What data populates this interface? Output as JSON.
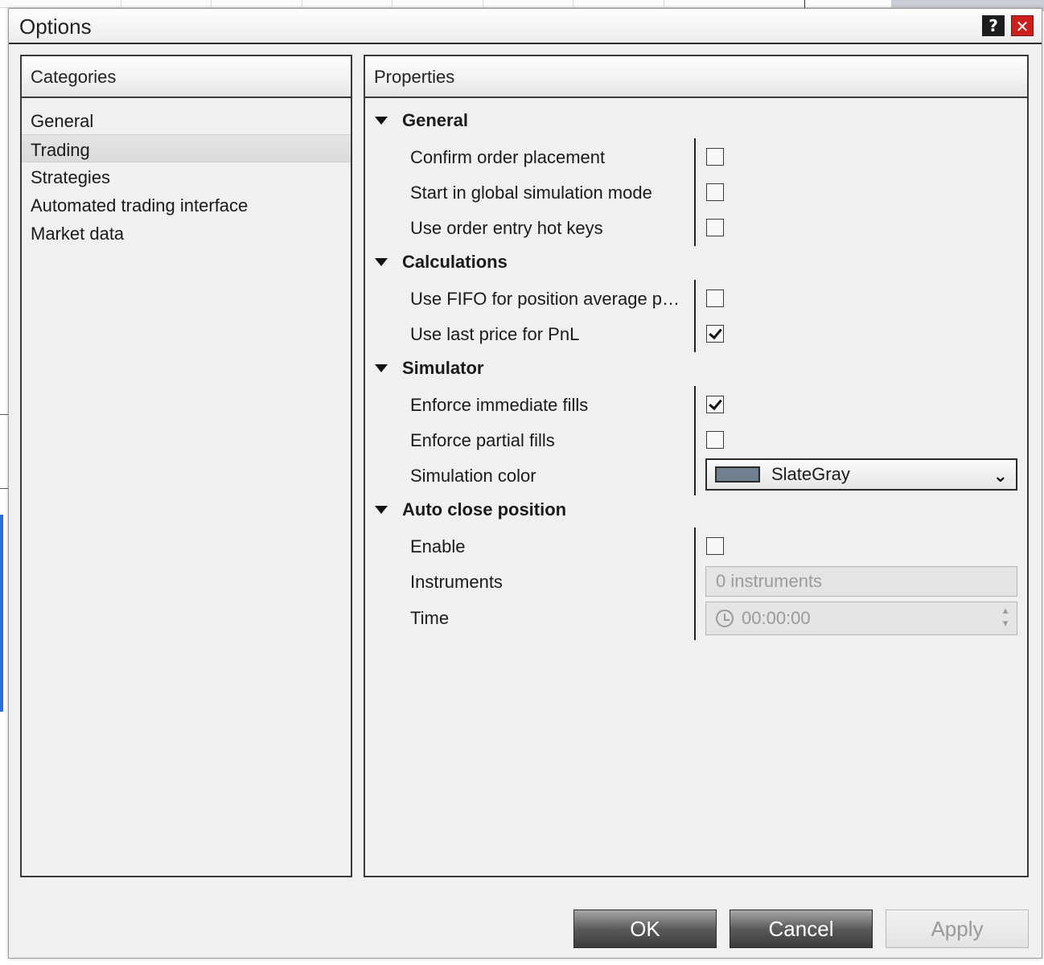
{
  "dialog": {
    "title": "Options",
    "help_icon": "?",
    "close_icon": "✕"
  },
  "categories": {
    "header": "Categories",
    "items": [
      {
        "label": "General",
        "selected": false
      },
      {
        "label": "Trading",
        "selected": true
      },
      {
        "label": "Strategies",
        "selected": false
      },
      {
        "label": "Automated trading interface",
        "selected": false
      },
      {
        "label": "Market data",
        "selected": false
      }
    ]
  },
  "properties": {
    "header": "Properties",
    "groups": [
      {
        "title": "General",
        "rows": [
          {
            "label": "Confirm order placement",
            "type": "checkbox",
            "checked": false
          },
          {
            "label": "Start in global simulation mode",
            "type": "checkbox",
            "checked": false
          },
          {
            "label": "Use order entry hot keys",
            "type": "checkbox",
            "checked": false
          }
        ]
      },
      {
        "title": "Calculations",
        "rows": [
          {
            "label": "Use FIFO for position average p…",
            "type": "checkbox",
            "checked": false
          },
          {
            "label": "Use last price for PnL",
            "type": "checkbox",
            "checked": true
          }
        ]
      },
      {
        "title": "Simulator",
        "rows": [
          {
            "label": "Enforce immediate fills",
            "type": "checkbox",
            "checked": true
          },
          {
            "label": "Enforce partial fills",
            "type": "checkbox",
            "checked": false
          },
          {
            "label": "Simulation color",
            "type": "select",
            "value": "SlateGray",
            "color": "#708090"
          }
        ]
      },
      {
        "title": "Auto close position",
        "rows": [
          {
            "label": "Enable",
            "type": "checkbox",
            "checked": false
          },
          {
            "label": "Instruments",
            "type": "text",
            "value": "0 instruments",
            "disabled": true
          },
          {
            "label": "Time",
            "type": "time",
            "value": "00:00:00",
            "disabled": true
          }
        ]
      }
    ]
  },
  "buttons": {
    "ok": "OK",
    "cancel": "Cancel",
    "apply": "Apply",
    "apply_disabled": true
  },
  "colors": {
    "close_button": "#c8201d",
    "help_button": "#1d1d1d",
    "simulation_color": "#708090"
  }
}
